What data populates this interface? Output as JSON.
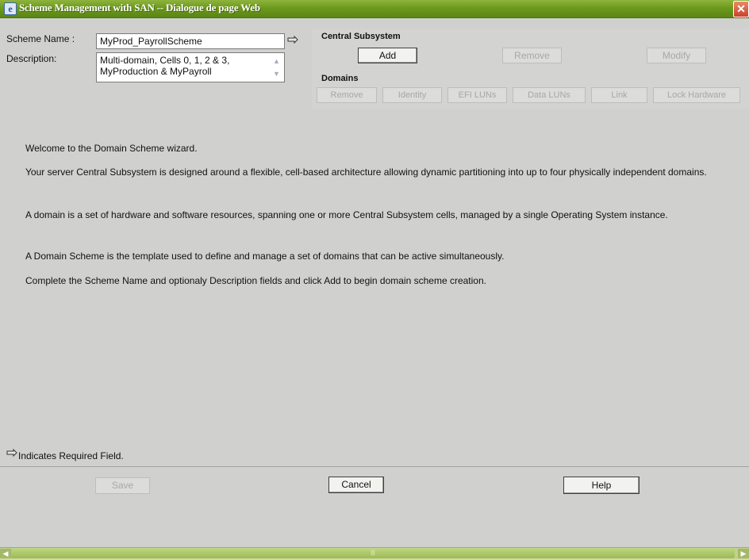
{
  "window": {
    "title": "Scheme Management with SAN -- Dialogue de page Web",
    "close_icon": "close-icon"
  },
  "form": {
    "scheme_name_label": "Scheme Name :",
    "scheme_name_value": "MyProd_PayrollScheme",
    "description_label": "Description:",
    "description_value": "Multi-domain, Cells 0, 1, 2 & 3, MyProduction & MyPayroll"
  },
  "central_subsystem": {
    "heading": "Central Subsystem",
    "buttons": {
      "add": "Add",
      "remove": "Remove",
      "modify": "Modify"
    }
  },
  "domains": {
    "heading": "Domains",
    "buttons": {
      "remove": "Remove",
      "identity": "Identity",
      "efi_luns": "EFI LUNs",
      "data_luns": "Data LUNs",
      "link": "Link",
      "lock_hardware": "Lock Hardware"
    }
  },
  "content": {
    "welcome": "Welcome to the Domain Scheme wizard.",
    "p1": "Your server Central Subsystem is designed around a flexible, cell-based architecture allowing dynamic partitioning into up to four physically independent domains.",
    "p2": "A domain is a set of hardware and software resources, spanning one or more Central Subsystem cells, managed by a single Operating System instance.",
    "p3": "A Domain Scheme is the template used to define and manage a set of domains that can be active simultaneously.",
    "p4": "Complete the Scheme Name and optionaly Description fields and click Add to begin domain scheme creation."
  },
  "footer": {
    "required_note": "Indicates Required Field.",
    "save": "Save",
    "cancel": "Cancel",
    "help": "Help"
  },
  "icons": {
    "required": "required-field-icon",
    "app": "ie-page-icon"
  }
}
